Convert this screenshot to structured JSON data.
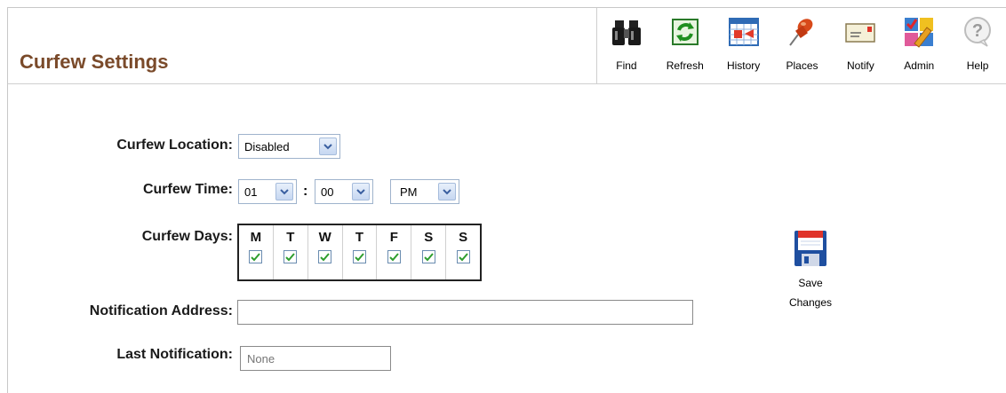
{
  "header": {
    "title": "Curfew Settings"
  },
  "toolbar": {
    "find": "Find",
    "refresh": "Refresh",
    "history": "History",
    "places": "Places",
    "notify": "Notify",
    "admin": "Admin",
    "help": "Help"
  },
  "form": {
    "location_label": "Curfew Location:",
    "location_value": "Disabled",
    "time_label": "Curfew Time:",
    "time_hour": "01",
    "time_sep": ":",
    "time_minute": "00",
    "time_ampm": "PM",
    "days_label": "Curfew Days:",
    "days": [
      {
        "letter": "M",
        "checked": true
      },
      {
        "letter": "T",
        "checked": true
      },
      {
        "letter": "W",
        "checked": true
      },
      {
        "letter": "T",
        "checked": true
      },
      {
        "letter": "F",
        "checked": true
      },
      {
        "letter": "S",
        "checked": true
      },
      {
        "letter": "S",
        "checked": true
      }
    ],
    "notification_address_label": "Notification Address:",
    "notification_address_value": "",
    "last_notification_label": "Last Notification:",
    "last_notification_placeholder": "None"
  },
  "save": {
    "line1": "Save",
    "line2": "Changes"
  },
  "colors": {
    "title": "#7a4a2a",
    "check": "#2e9e2e",
    "select_border": "#9fb3cc"
  }
}
